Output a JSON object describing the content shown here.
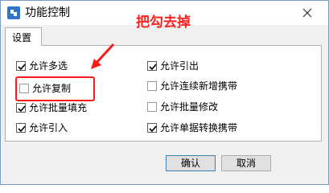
{
  "window": {
    "title": "功能控制"
  },
  "annotation": {
    "text": "把勾去掉",
    "color": "#ff2020"
  },
  "tabs": [
    {
      "label": "设置"
    }
  ],
  "options": {
    "left": [
      {
        "label": "允许多选",
        "checked": true
      },
      {
        "label": "允许复制",
        "checked": false
      },
      {
        "label": "允许批量填充",
        "checked": true
      },
      {
        "label": "允许引入",
        "checked": true
      }
    ],
    "right": [
      {
        "label": "允许引出",
        "checked": true
      },
      {
        "label": "允许连续新增携带",
        "checked": false
      },
      {
        "label": "允许批量修改",
        "checked": false
      },
      {
        "label": "允许单据转换携带",
        "checked": true
      }
    ]
  },
  "buttons": {
    "ok": "确认",
    "cancel": "取消"
  },
  "icons": {
    "app": "app-icon",
    "close": "close-icon",
    "check": "checkmark-icon",
    "arrow": "arrow-icon"
  }
}
